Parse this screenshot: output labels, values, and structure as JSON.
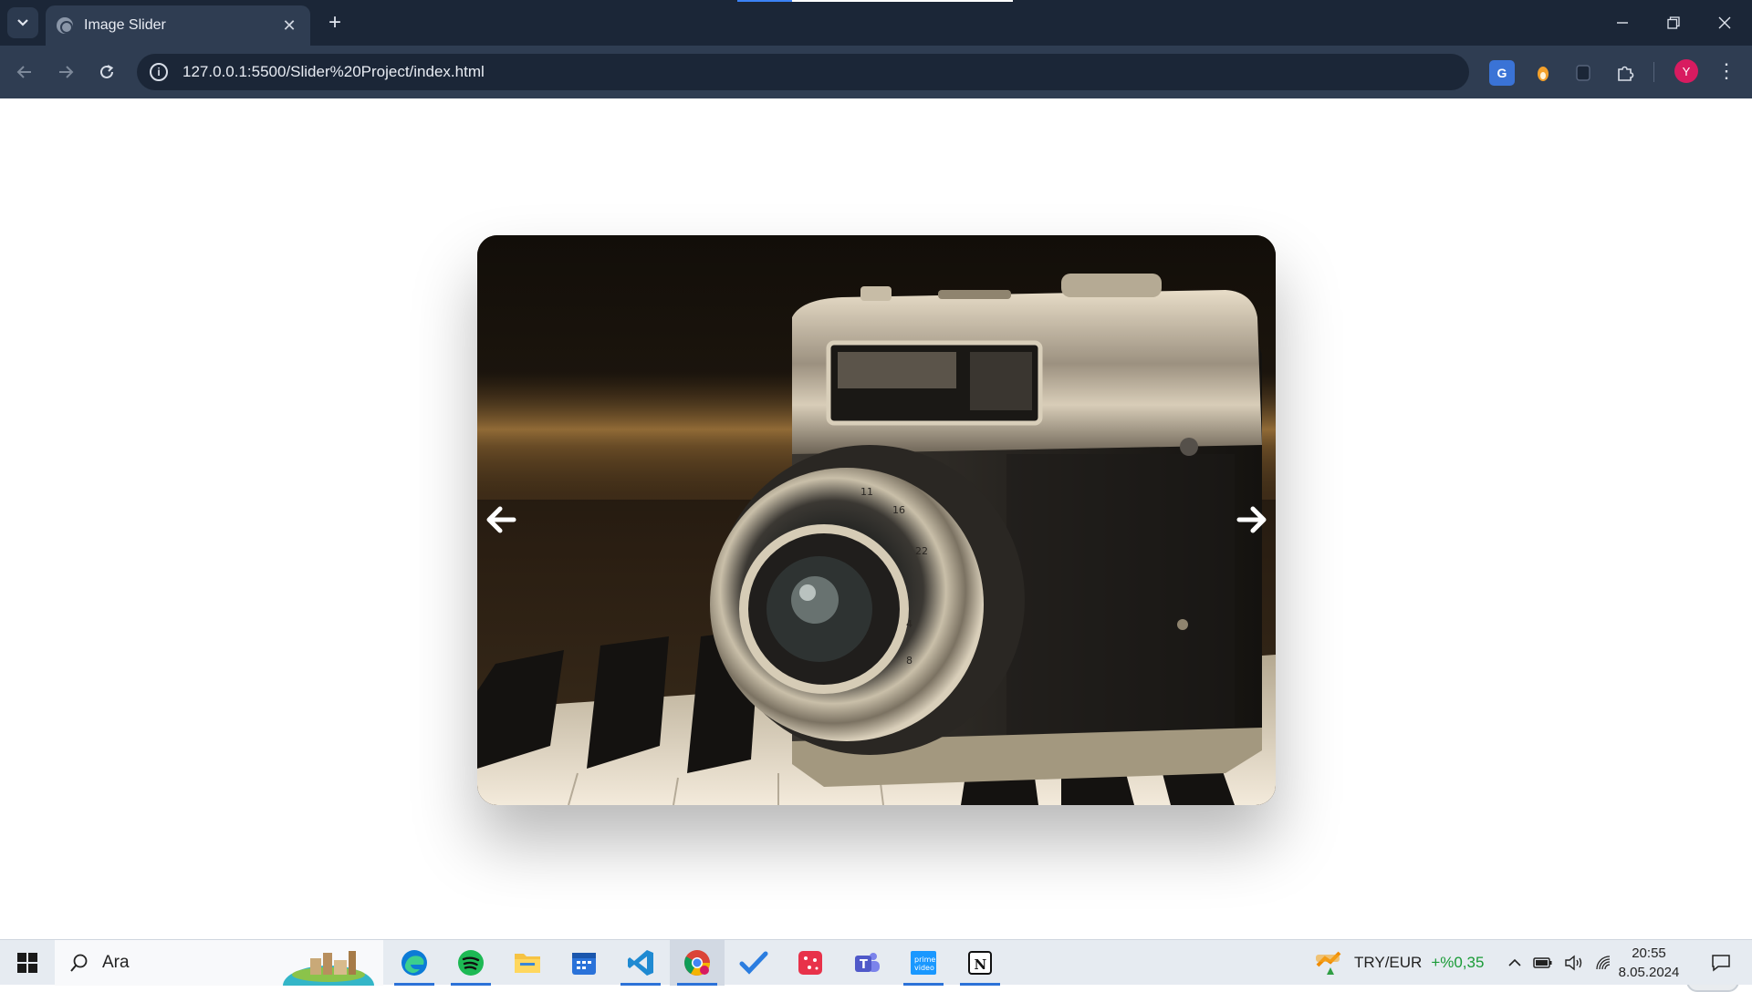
{
  "browser": {
    "tab_title": "Image Slider",
    "url": "127.0.0.1:5500/Slider%20Project/index.html",
    "profile_initial": "Y",
    "accent": "#1b2637"
  },
  "slider": {
    "prev_label": "previous slide",
    "next_label": "next slide",
    "image_subject": "vintage camera on piano keys"
  },
  "taskbar": {
    "search_placeholder": "Ara",
    "apps": [
      "edge",
      "spotify",
      "file-explorer",
      "calendar",
      "vscode",
      "chrome",
      "todo",
      "app-red",
      "teams",
      "prime-video",
      "notion"
    ],
    "active_app": "chrome",
    "ticker_label": "TRY/EUR",
    "ticker_change": "+%0,35",
    "time": "20:55",
    "date": "8.05.2024"
  }
}
